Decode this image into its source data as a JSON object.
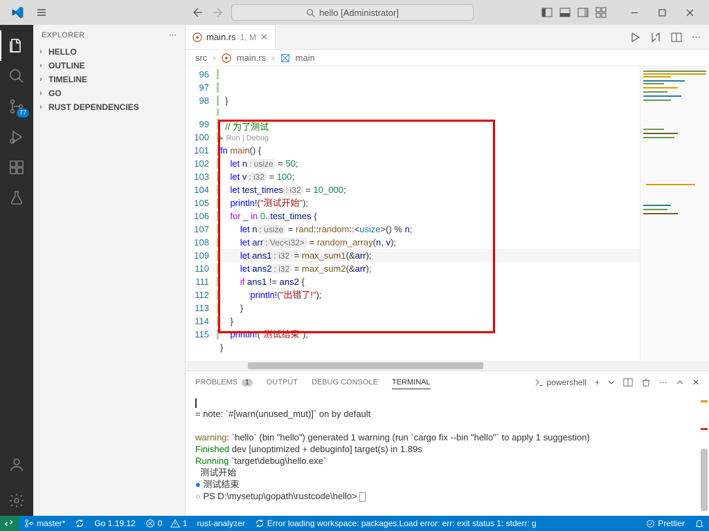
{
  "titlebar": {
    "search_placeholder": "hello [Administrator]"
  },
  "sidebar": {
    "title": "EXPLORER",
    "sections": [
      "HELLO",
      "OUTLINE",
      "TIMELINE",
      "GO",
      "RUST DEPENDENCIES"
    ]
  },
  "activitybar": {
    "scm_badge": "77"
  },
  "tabs": {
    "file": "main.rs",
    "mod": "1, M"
  },
  "breadcrumb": {
    "items": [
      "src",
      "main.rs",
      "main"
    ]
  },
  "editor": {
    "codelens": "Run | Debug",
    "line_start": 96,
    "lines": [
      {
        "n": 96,
        "html": "  <span class='pun'>}</span>"
      },
      {
        "n": 97,
        "html": ""
      },
      {
        "n": 98,
        "html": "  <span class='cmt'>// 为了测试</span>"
      },
      {
        "n": 99,
        "html": "<span class='kw'>fn</span> <span class='fn'>main</span>() {"
      },
      {
        "n": 100,
        "html": "    <span class='kw'>let</span> <span class='var'>n</span><span class='hint'>: usize</span> = <span class='num'>50</span>;"
      },
      {
        "n": 101,
        "html": "    <span class='kw'>let</span> <span class='var'>v</span><span class='hint'>: i32</span> = <span class='num'>100</span>;"
      },
      {
        "n": 102,
        "html": "    <span class='kw'>let</span> <span class='var'>test_times</span><span class='hint'>: i32</span> = <span class='num'>10_000</span>;"
      },
      {
        "n": 103,
        "html": "    <span class='macro'>println!</span>(<span class='str'>\"测试开始\"</span>);"
      },
      {
        "n": 104,
        "html": "    <span class='ctrl'>for</span> <span class='var'>_</span> <span class='ctrl'>in</span> <span class='num'>0</span>..<span class='var'>test_times</span> {"
      },
      {
        "n": 105,
        "html": "        <span class='kw'>let</span> <span class='var'>n</span><span class='hint'>: usize</span> = <span class='fn'>rand</span>::<span class='fn'>random</span>::&lt;<span class='ty'>usize</span>&gt;() % <span class='var'>n</span>;"
      },
      {
        "n": 106,
        "html": "        <span class='kw'>let</span> <span class='var'>arr</span><span class='hint'>: Vec&lt;i32&gt;</span> = <span class='fn'>random_array</span>(<span class='var'>n</span>, <span class='var'>v</span>);"
      },
      {
        "n": 107,
        "html": "        <span class='kw'>let</span> <span class='var'>ans1</span><span class='hint'>: i32</span> = <span class='fn'>max_sum1</span>(&amp;<span class='var'>arr</span>);",
        "current": true
      },
      {
        "n": 108,
        "html": "        <span class='kw'>let</span> <span class='var'>ans2</span><span class='hint'>: i32</span> = <span class='fn'>max_sum2</span>(&amp;<span class='var'>arr</span>);"
      },
      {
        "n": 109,
        "html": "        <span class='ctrl'>if</span> <span class='var'>ans1</span> != <span class='var'>ans2</span> {"
      },
      {
        "n": 110,
        "html": "            <span class='macro'>println!</span>(<span class='str'>\"出错了!\"</span>);"
      },
      {
        "n": 111,
        "html": "        }"
      },
      {
        "n": 112,
        "html": "    }"
      },
      {
        "n": 113,
        "html": "    <span class='macro'>println!</span>(<span class='str'>\"测试结束\"</span>);"
      },
      {
        "n": 114,
        "html": "}"
      },
      {
        "n": 115,
        "html": ""
      }
    ]
  },
  "panel": {
    "tabs": {
      "problems": "PROBLEMS",
      "problems_badge": "1",
      "output": "OUTPUT",
      "debug": "DEBUG CONSOLE",
      "terminal": "TERMINAL"
    },
    "shell_label": "powershell",
    "terminal_lines": [
      {
        "cls": "",
        "text": " = note: `#[warn(unused_mut)]` on by default"
      },
      {
        "cls": "",
        "text": ""
      },
      {
        "cls": "yellow",
        "text": "warning"
      },
      {
        "cls": "",
        "text": ": `hello` (bin \"hello\") generated 1 warning (run `cargo fix --bin \"hello\"` to apply 1 suggestion)"
      },
      {
        "cls": "green",
        "text": "    Finished"
      },
      {
        "cls": "",
        "text": " dev [unoptimized + debuginfo] target(s) in 1.89s"
      },
      {
        "cls": "green",
        "text": "     Running"
      },
      {
        "cls": "",
        "text": " `target\\debug\\hello.exe`"
      },
      {
        "cls": "",
        "text": "测试开始"
      },
      {
        "cls": "",
        "text": "测试结束"
      },
      {
        "cls": "",
        "text": "PS D:\\mysetup\\gopath\\rustcode\\hello> "
      }
    ]
  },
  "statusbar": {
    "branch": "master*",
    "go_ver": "Go 1.19.12",
    "errors": "0",
    "warnings": "1",
    "rust": "rust-analyzer",
    "error_text": "Error loading workspace: packages.Load error: err: exit status 1: stderr: g",
    "prettier": "Prettier"
  }
}
